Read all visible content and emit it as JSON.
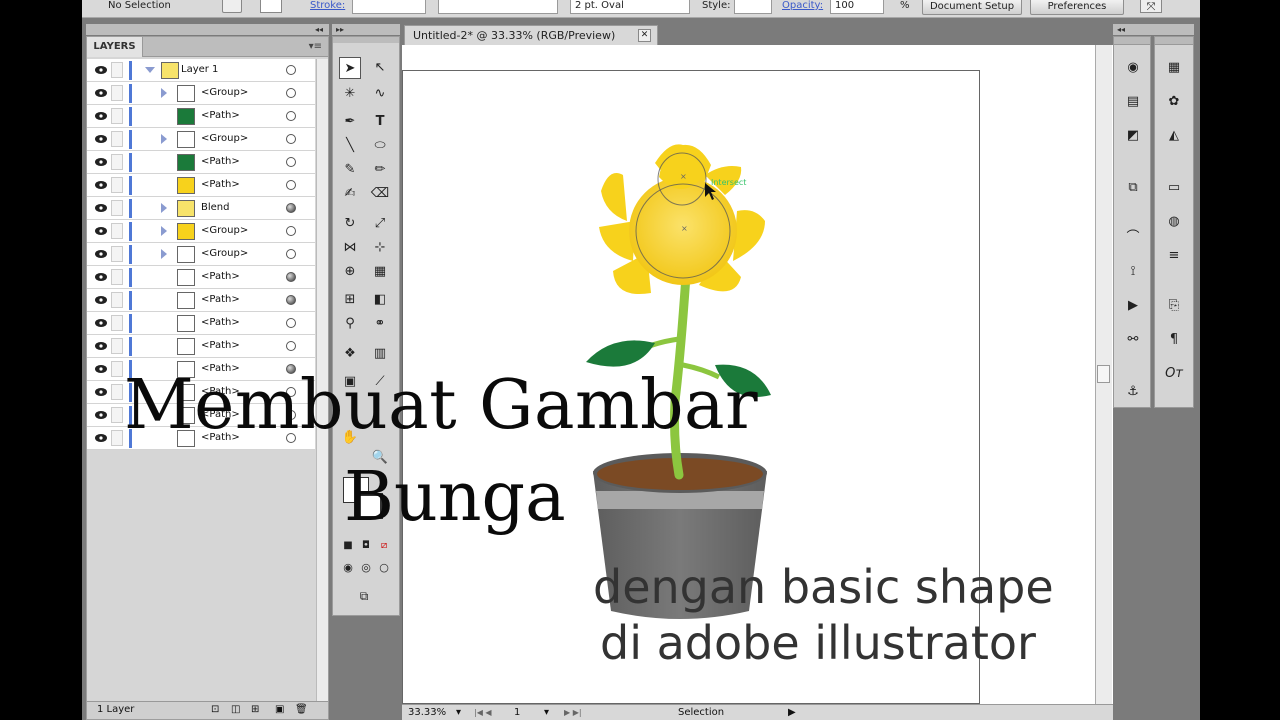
{
  "control_bar": {
    "selection_label": "No Selection",
    "stroke_label": "Stroke:",
    "brush_value": "2 pt. Oval",
    "style_label": "Style:",
    "opacity_label": "Opacity:",
    "opacity_value": "100",
    "opacity_unit": "%",
    "document_setup": "Document Setup",
    "preferences": "Preferences"
  },
  "layers_panel": {
    "tab": "LAYERS",
    "menu_icon": "panel-menu-icon",
    "footer_count": "1 Layer",
    "rows": [
      {
        "label": "Layer 1",
        "type": "layer",
        "target": "empty"
      },
      {
        "label": "<Group>",
        "type": "group",
        "target": "empty"
      },
      {
        "label": "<Path>",
        "type": "path",
        "target": "empty"
      },
      {
        "label": "<Group>",
        "type": "group",
        "target": "empty"
      },
      {
        "label": "<Path>",
        "type": "path",
        "target": "empty"
      },
      {
        "label": "<Path>",
        "type": "path",
        "target": "empty"
      },
      {
        "label": "Blend",
        "type": "group",
        "target": "filled"
      },
      {
        "label": "<Group>",
        "type": "group",
        "target": "empty"
      },
      {
        "label": "<Group>",
        "type": "group",
        "target": "empty"
      },
      {
        "label": "<Path>",
        "type": "path",
        "target": "filled"
      },
      {
        "label": "<Path>",
        "type": "path",
        "target": "filled"
      },
      {
        "label": "<Path>",
        "type": "path",
        "target": "empty"
      },
      {
        "label": "<Path>",
        "type": "path",
        "target": "empty"
      },
      {
        "label": "<Path>",
        "type": "path",
        "target": "filled"
      },
      {
        "label": "<Path>",
        "type": "path",
        "target": "empty"
      },
      {
        "label": "<Path>",
        "type": "path",
        "target": "empty"
      },
      {
        "label": "<Path>",
        "type": "path",
        "target": "empty"
      }
    ]
  },
  "document": {
    "tab_title": "Untitled-2* @ 33.33% (RGB/Preview)",
    "smart_guide": "Intersect"
  },
  "status_bar": {
    "zoom": "33.33%",
    "page": "1",
    "tool": "Selection"
  },
  "overlay": {
    "title_line1": "Membuat Gambar",
    "title_line2": "Bunga",
    "subtitle_line1": "dengan basic shape",
    "subtitle_line2": "di adobe illustrator"
  },
  "colors": {
    "petal": "#f7d21c",
    "leaf": "#1b7a3a",
    "stem": "#8cc63f",
    "soil": "#7b4a24",
    "pot": "#6d6d6d",
    "pot_band": "#a0a0a0",
    "layer_bar": "#4f78d6"
  }
}
